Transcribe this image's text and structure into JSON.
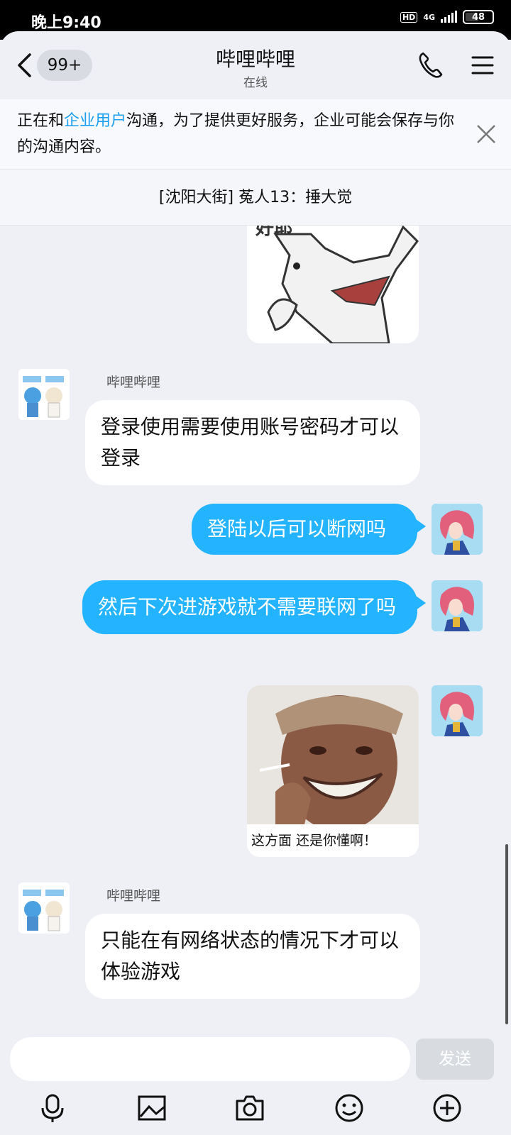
{
  "status_bar": {
    "time": "晚上9:40",
    "hd": "HD",
    "network": "4G",
    "battery": "48"
  },
  "header": {
    "badge": "99+",
    "title": "哔哩哔哩",
    "subtitle": "在线"
  },
  "notice": {
    "text_before": "正在和",
    "link": "企业用户",
    "text_after": "沟通，为了提供更好服务，企业可能会保存与你的沟通内容。"
  },
  "pinned": {
    "text": "[沈阳大街] 菟人13：捶大觉"
  },
  "messages": [
    {
      "from": "bot",
      "type": "sticker",
      "text": "好耶"
    },
    {
      "from": "bot",
      "type": "text",
      "sender": "哔哩哔哩",
      "text": "登录使用需要使用账号密码才可以登录"
    },
    {
      "from": "me",
      "type": "text",
      "text": "登陆以后可以断网吗"
    },
    {
      "from": "me",
      "type": "text",
      "text": "然后下次进游戏就不需要联网了吗"
    },
    {
      "from": "me",
      "type": "sticker",
      "caption": "这方面 还是你懂啊！"
    },
    {
      "from": "bot",
      "type": "text",
      "sender": "哔哩哔哩",
      "text": "只能在有网络状态的情况下才可以体验游戏"
    }
  ],
  "input": {
    "send_label": "发送"
  },
  "toolbar": [
    "mic-icon",
    "image-icon",
    "camera-icon",
    "emoji-icon",
    "plus-icon"
  ],
  "colors": {
    "accent": "#23b3ff",
    "link": "#1a9ff0",
    "background": "#eef0f6"
  }
}
